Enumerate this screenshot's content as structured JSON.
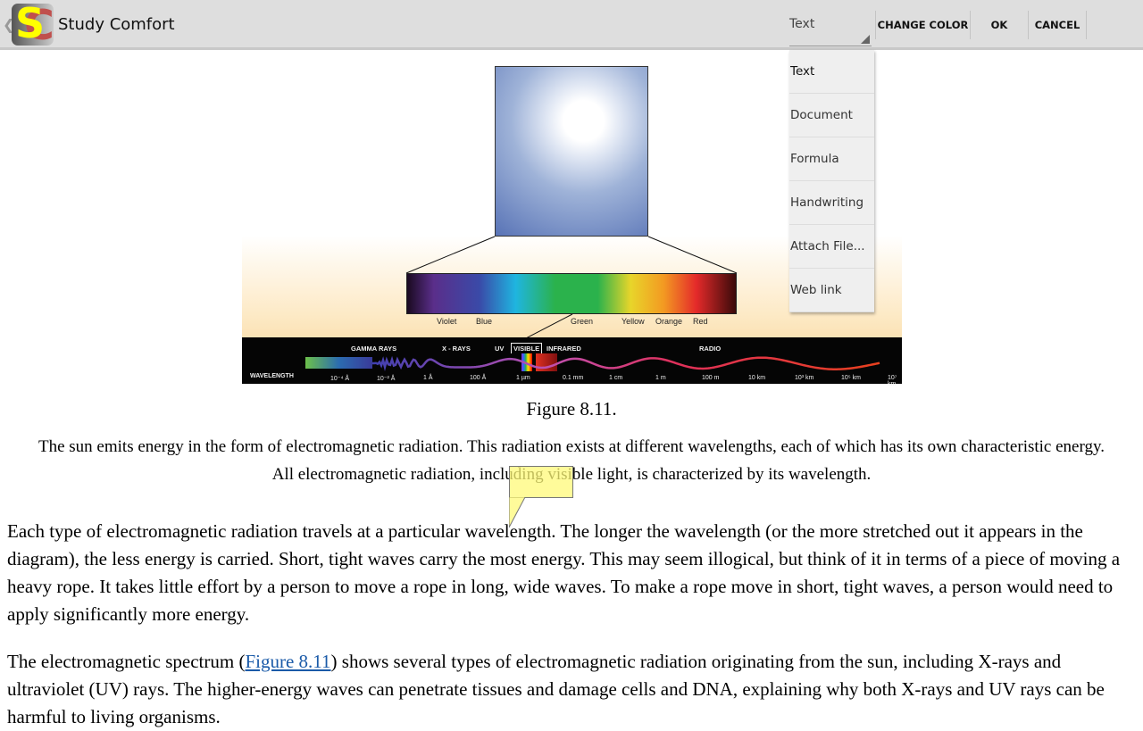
{
  "app": {
    "title": "Study Comfort",
    "logo_letters": "SC"
  },
  "toolbar": {
    "type_selected": "Text",
    "change_color": "CHANGE COLOR",
    "ok": "OK",
    "cancel": "CANCEL"
  },
  "dropdown": {
    "options": [
      "Text",
      "Document",
      "Formula",
      "Handwriting",
      "Attach File...",
      "Web link"
    ]
  },
  "figure": {
    "colors": [
      "Violet",
      "Blue",
      "Green",
      "Yellow",
      "Orange",
      "Red"
    ],
    "bands": [
      "GAMMA RAYS",
      "X - RAYS",
      "UV",
      "VISIBLE",
      "INFRARED",
      "RADIO"
    ],
    "wavelength_label": "WAVELENGTH",
    "ticks": [
      "10⁻⁴ Å",
      "10⁻² Å",
      "1 Å",
      "100 Å",
      "1 µm",
      "0.1 mm",
      "1 cm",
      "1 m",
      "100 m",
      "10 km",
      "10³ km",
      "10⁵ km",
      "10⁷ km"
    ],
    "caption": "Figure 8.11."
  },
  "content": {
    "caption_text_1": "The sun emits energy in the form of electromagnetic radiation. This radiation exists at different wavelengths, each of which has its own characteristic energy.",
    "caption_text_2": "All electromagnetic radiation, including visible light, is characterized by its wavelength.",
    "para1": "Each type of electromagnetic radiation travels at a particular wavelength. The longer the wavelength (or the more stretched out it appears in the diagram), the less energy is carried. Short, tight waves carry the most energy. This may seem illogical, but think of it in terms of a piece of moving a heavy rope. It takes little effort by a person to move a rope in long, wide waves. To make a rope move in short, tight waves, a person would need to apply significantly more energy.",
    "para2_a": "The electromagnetic spectrum (",
    "para2_link": "Figure 8.11",
    "para2_b": ") shows several types of electromagnetic radiation originating from the sun, including X-rays and ultraviolet (UV) rays. The higher-energy waves can penetrate tissues and damage cells and DNA, explaining why both X-rays and UV rays can be harmful to living organisms."
  },
  "note_color": "#fff878"
}
